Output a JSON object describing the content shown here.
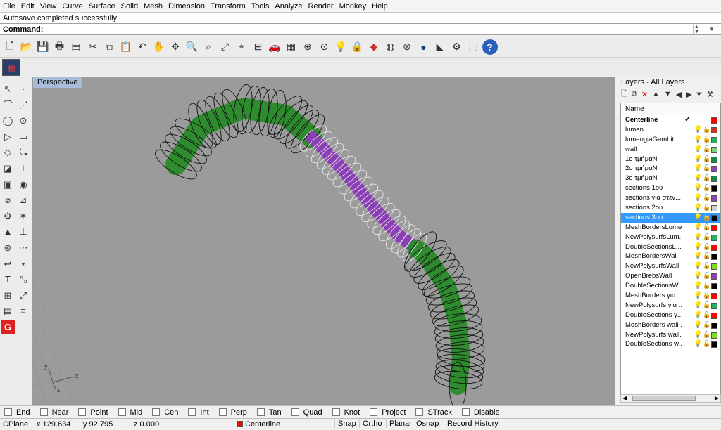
{
  "menu": [
    "File",
    "Edit",
    "View",
    "Curve",
    "Surface",
    "Solid",
    "Mesh",
    "Dimension",
    "Transform",
    "Tools",
    "Analyze",
    "Render",
    "Monkey",
    "Help"
  ],
  "history_text": "Autosave completed successfully",
  "command": {
    "label": "Command:"
  },
  "toolbar_icons": [
    "new-icon",
    "open-icon",
    "save-icon",
    "print-icon",
    "properties-icon",
    "cut-icon",
    "copy-icon",
    "paste-icon",
    "undo-icon",
    "pan-icon",
    "rotate-view-icon",
    "zoom-icon",
    "zoom-window-icon",
    "zoom-extents-icon",
    "zoom-selected-icon",
    "four-viewports-icon",
    "car-icon",
    "grid-icon",
    "cplane-icon",
    "object-snap-icon",
    "light-icon",
    "lock-icon",
    "shaded-icon",
    "color-wheel-icon",
    "wireframe-icon",
    "sphere-render-icon",
    "material-icon",
    "render-options-icon",
    "selection-filter-icon",
    "help-icon"
  ],
  "viewport": {
    "title": "Perspective"
  },
  "axes": {
    "x": "x",
    "y": "y",
    "z": "z"
  },
  "layers_panel": {
    "title": "Layers - All Layers",
    "name_header": "Name",
    "layers": [
      {
        "name": "Centerline",
        "color": "#ff0000",
        "current": true
      },
      {
        "name": "lumen",
        "color": "#c0392b"
      },
      {
        "name": "lumengiaGambit",
        "color": "#27ae60"
      },
      {
        "name": "wall",
        "color": "#7ed67a"
      },
      {
        "name": "1ο τμήμαΝ",
        "color": "#1e8449"
      },
      {
        "name": "2ο τμήμαΝ",
        "color": "#8e44ad"
      },
      {
        "name": "3ο τμήμαΝ",
        "color": "#1e8449"
      },
      {
        "name": "sections 1ου",
        "color": "#000000"
      },
      {
        "name": "sections για στέν...",
        "color": "#8e44ad"
      },
      {
        "name": "sections 2ου",
        "color": "#d0d0d0"
      },
      {
        "name": "sections 3ου",
        "color": "#000000",
        "selected": true
      },
      {
        "name": "MeshBordersLumen",
        "color": "#ff0000"
      },
      {
        "name": "NewPolysurfsLum...",
        "color": "#27ae60"
      },
      {
        "name": "DoubleSectionsL...",
        "color": "#ff0000"
      },
      {
        "name": "MeshBordersWall",
        "color": "#000000"
      },
      {
        "name": "NewPolysurfsWall",
        "color": "#7fdc1f"
      },
      {
        "name": "OpenBrebsWall",
        "color": "#8e44ad"
      },
      {
        "name": "DoubleSectionsW...",
        "color": "#000000"
      },
      {
        "name": "MeshBorders για ...",
        "color": "#ff0000"
      },
      {
        "name": "NewPolysurfs για ...",
        "color": "#27ae60"
      },
      {
        "name": "DoubleSections γ...",
        "color": "#ff0000"
      },
      {
        "name": "MeshBorders wall ...",
        "color": "#000000"
      },
      {
        "name": "NewPolysurfs wall...",
        "color": "#7fdc1f"
      },
      {
        "name": "DoubleSections w...",
        "color": "#000000"
      }
    ]
  },
  "osnap": [
    "End",
    "Near",
    "Point",
    "Mid",
    "Cen",
    "Int",
    "Perp",
    "Tan",
    "Quad",
    "Knot",
    "Project",
    "STrack",
    "Disable"
  ],
  "status": {
    "cplane": "CPlane",
    "x": "x 129.634",
    "y": "y 92.795",
    "z": "z 0.000",
    "layer": "Centerline",
    "snap": "Snap",
    "ortho": "Ortho",
    "planar": "Planar",
    "osnap": "Osnap",
    "record": "Record History"
  }
}
